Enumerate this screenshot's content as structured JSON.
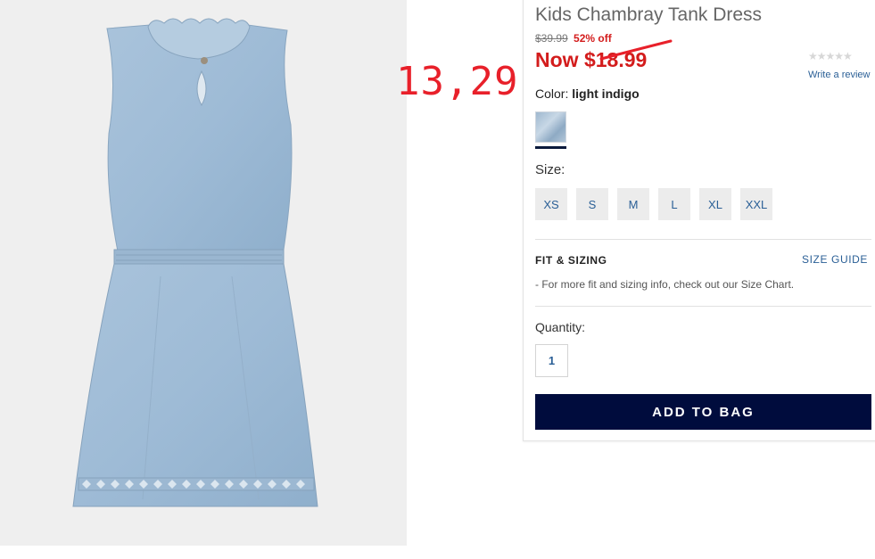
{
  "product": {
    "title": "Kids Chambray Tank Dress",
    "original_price": "$39.99",
    "discount": "52% off",
    "now_prefix": "Now ",
    "now_price": "$18.99"
  },
  "annotation": {
    "handwritten_price": "13,29",
    "color": "#e8202a"
  },
  "reviews": {
    "stars": "★★★★★",
    "write_review": "Write a review"
  },
  "color": {
    "label": "Color:",
    "value": "light indigo"
  },
  "size": {
    "label": "Size:",
    "options": [
      "XS",
      "S",
      "M",
      "L",
      "XL",
      "XXL"
    ]
  },
  "fit": {
    "title": "FIT & SIZING",
    "guide_link": "SIZE GUIDE",
    "text": "- For more fit and sizing info, check out our Size Chart."
  },
  "quantity": {
    "label": "Quantity:",
    "value": "1"
  },
  "cta": {
    "label": "ADD TO BAG"
  },
  "colors": {
    "sale_red": "#d31c1c",
    "link_blue": "#2a5f96",
    "cta_navy": "#000c3d"
  }
}
